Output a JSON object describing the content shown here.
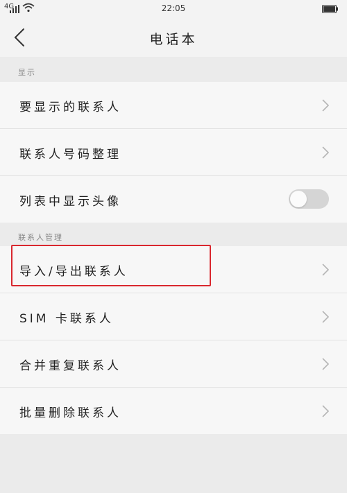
{
  "status_bar": {
    "network": "4G",
    "time": "22:05"
  },
  "header": {
    "title": "电话本",
    "back_icon": "chevron-left-icon"
  },
  "sections": [
    {
      "label": "显示",
      "items": [
        {
          "label": "要显示的联系人",
          "type": "chevron"
        },
        {
          "label": "联系人号码整理",
          "type": "chevron"
        },
        {
          "label": "列表中显示头像",
          "type": "toggle",
          "toggle_on": false
        }
      ]
    },
    {
      "label": "联系人管理",
      "items": [
        {
          "label": "导入/导出联系人",
          "type": "chevron",
          "highlighted": true
        },
        {
          "label": "SIM 卡联系人",
          "type": "chevron"
        },
        {
          "label": "合并重复联系人",
          "type": "chevron"
        },
        {
          "label": "批量删除联系人",
          "type": "chevron"
        }
      ]
    }
  ],
  "colors": {
    "highlight": "#d9272e",
    "toggle_off": "#d5d5d5"
  }
}
